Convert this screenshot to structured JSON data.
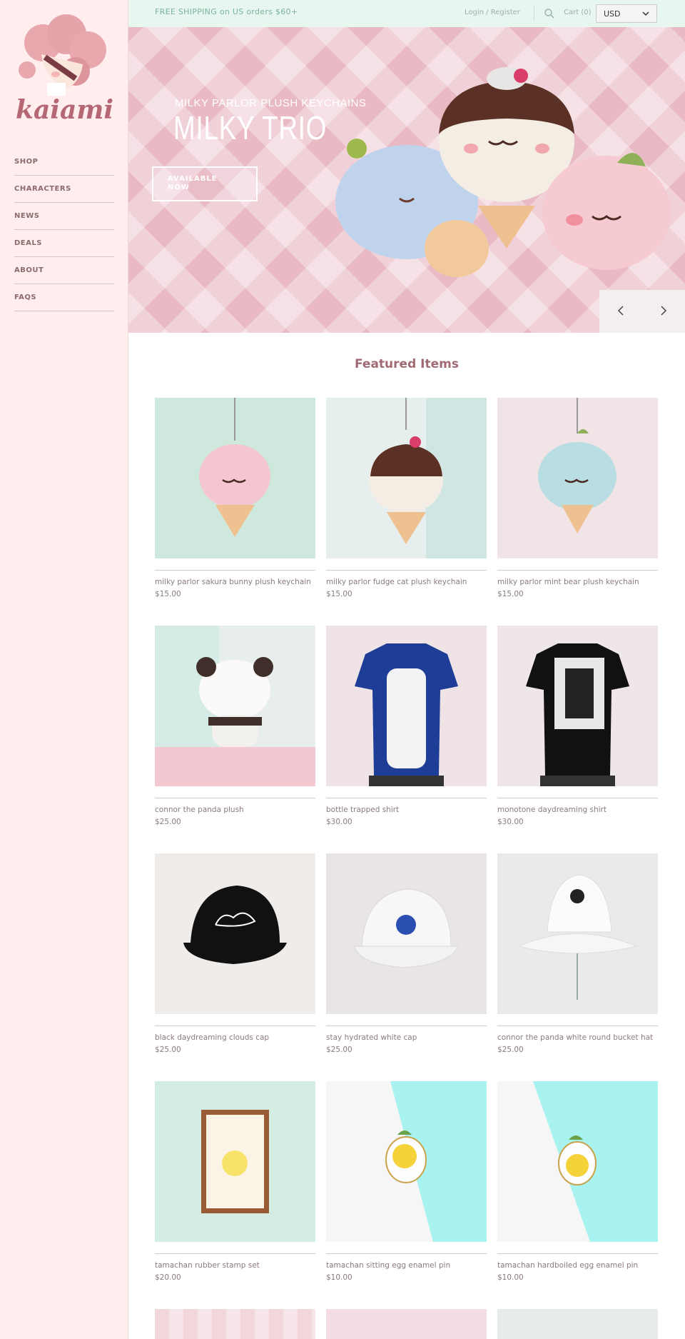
{
  "brand": {
    "name": "kaiami"
  },
  "nav": {
    "items": [
      "SHOP",
      "CHARACTERS",
      "NEWS",
      "DEALS",
      "ABOUT",
      "FAQS"
    ]
  },
  "topbar": {
    "shipping": "FREE SHIPPING on US orders $60+",
    "login": "Login / Register",
    "cart": "Cart (0)",
    "currency": "USD"
  },
  "hero": {
    "subtitle": "MILKY PARLOR PLUSH KEYCHAINS",
    "title": "MILKY TRIO",
    "button": "AVAILABLE NOW"
  },
  "featured": {
    "title": "Featured Items",
    "products": [
      {
        "name": "milky parlor sakura bunny plush keychain",
        "price": "$15.00",
        "bg": "#cfe8dd"
      },
      {
        "name": "milky parlor fudge cat plush keychain",
        "price": "$15.00",
        "bg": "#e6eeee"
      },
      {
        "name": "milky parlor mint bear plush keychain",
        "price": "$15.00",
        "bg": "#f1e4e6"
      },
      {
        "name": "connor the panda plush",
        "price": "$25.00",
        "bg": "#e8eeec"
      },
      {
        "name": "bottle trapped shirt",
        "price": "$30.00",
        "bg": "#efe3e6"
      },
      {
        "name": "monotone daydreaming shirt",
        "price": "$30.00",
        "bg": "#efe6e8"
      },
      {
        "name": "black daydreaming clouds cap",
        "price": "$25.00",
        "bg": "#efecea"
      },
      {
        "name": "stay hydrated white cap",
        "price": "$25.00",
        "bg": "#e9e4e6"
      },
      {
        "name": "connor the panda white round bucket hat",
        "price": "$25.00",
        "bg": "#ece9eb"
      },
      {
        "name": "tamachan rubber stamp set",
        "price": "$20.00",
        "bg": "#d4ede3"
      },
      {
        "name": "tamachan sitting egg enamel pin",
        "price": "$10.00",
        "bg": "#a8f2ef"
      },
      {
        "name": "tamachan hardboiled egg enamel pin",
        "price": "$10.00",
        "bg": "#a8f2ef"
      }
    ]
  }
}
